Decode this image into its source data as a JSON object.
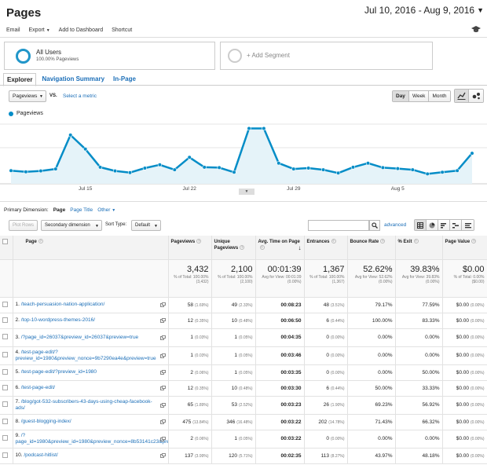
{
  "header": {
    "title": "Pages",
    "date_range": "Jul 10, 2016 - Aug 9, 2016",
    "actions": [
      "Email",
      "Export",
      "Add to Dashboard",
      "Shortcut"
    ]
  },
  "segments": {
    "active": {
      "name": "All Users",
      "sub": "100.00% Pageviews"
    },
    "add_label": "+ Add Segment"
  },
  "tabs": [
    "Explorer",
    "Navigation Summary",
    "In-Page"
  ],
  "metric": {
    "selected": "Pageviews",
    "vs": "VS.",
    "select_metric": "Select a metric"
  },
  "period_buttons": [
    "Day",
    "Week",
    "Month"
  ],
  "chart_data": {
    "type": "area",
    "series": [
      {
        "name": "Pageviews",
        "values": [
          80,
          72,
          78,
          90,
          295,
          210,
          100,
          78,
          68,
          95,
          115,
          85,
          160,
          100,
          98,
          70,
          335,
          335,
          125,
          90,
          95,
          85,
          65,
          100,
          125,
          98,
          92,
          85,
          60,
          70,
          80,
          185
        ]
      }
    ],
    "x_tick_labels": [
      "Jul 15",
      "Jul 22",
      "Jul 29",
      "Aug 5"
    ],
    "ylim": [
      0,
      380
    ],
    "grid": true,
    "color": "#058dc7"
  },
  "primary_dimension": {
    "label": "Primary Dimension:",
    "options": [
      "Page",
      "Page Title",
      "Other"
    ]
  },
  "toolbar": {
    "plot_rows": "Plot Rows",
    "secondary_dimension": "Secondary dimension",
    "sort_type_label": "Sort Type:",
    "sort_type": "Default",
    "advanced": "advanced"
  },
  "table": {
    "columns": [
      "Page",
      "Pageviews",
      "Unique Pageviews",
      "Avg. Time on Page",
      "Entrances",
      "Bounce Rate",
      "% Exit",
      "Page Value"
    ],
    "totals": [
      {
        "value": "3,432",
        "sub": "% of Total: 100.00% (3,432)"
      },
      {
        "value": "2,100",
        "sub": "% of Total: 100.00% (2,100)"
      },
      {
        "value": "00:01:39",
        "sub": "Avg for View: 00:01:39 (0.00%)"
      },
      {
        "value": "1,367",
        "sub": "% of Total: 100.00% (1,367)"
      },
      {
        "value": "52.62%",
        "sub": "Avg for View: 52.62% (0.00%)"
      },
      {
        "value": "39.83%",
        "sub": "Avg for View: 39.83% (0.00%)"
      },
      {
        "value": "$0.00",
        "sub": "% of Total: 0.00% ($0.00)"
      }
    ],
    "rows": [
      {
        "idx": "1.",
        "page": "/teach-persuasion-nation-application/",
        "pv": "58",
        "pv_pct": "(1.69%)",
        "upv": "49",
        "upv_pct": "(2.33%)",
        "time": "00:08:23",
        "ent": "48",
        "ent_pct": "(3.51%)",
        "bounce": "79.17%",
        "exit": "77.59%",
        "value": "$0.00",
        "value_pct": "(0.00%)"
      },
      {
        "idx": "2.",
        "page": "/top-10-wordpress-themes-2016/",
        "pv": "12",
        "pv_pct": "(0.35%)",
        "upv": "10",
        "upv_pct": "(0.48%)",
        "time": "00:06:50",
        "ent": "6",
        "ent_pct": "(0.44%)",
        "bounce": "100.00%",
        "exit": "83.33%",
        "value": "$0.00",
        "value_pct": "(0.00%)"
      },
      {
        "idx": "3.",
        "page": "/?page_id=26037&preview_id=26037&preview=true",
        "pv": "1",
        "pv_pct": "(0.03%)",
        "upv": "1",
        "upv_pct": "(0.05%)",
        "time": "00:04:35",
        "ent": "0",
        "ent_pct": "(0.00%)",
        "bounce": "0.00%",
        "exit": "0.00%",
        "value": "$0.00",
        "value_pct": "(0.00%)"
      },
      {
        "idx": "4.",
        "page": "/test-page-edit/?preview_id=1980&preview_nonce=9b7290ea4e&preview=true",
        "pv": "1",
        "pv_pct": "(0.03%)",
        "upv": "1",
        "upv_pct": "(0.05%)",
        "time": "00:03:46",
        "ent": "0",
        "ent_pct": "(0.00%)",
        "bounce": "0.00%",
        "exit": "0.00%",
        "value": "$0.00",
        "value_pct": "(0.00%)"
      },
      {
        "idx": "5.",
        "page": "/test-page-edit/?preview_id=1980",
        "pv": "2",
        "pv_pct": "(0.06%)",
        "upv": "1",
        "upv_pct": "(0.05%)",
        "time": "00:03:35",
        "ent": "0",
        "ent_pct": "(0.00%)",
        "bounce": "0.00%",
        "exit": "50.00%",
        "value": "$0.00",
        "value_pct": "(0.00%)"
      },
      {
        "idx": "6.",
        "page": "/test-page-edit/",
        "pv": "12",
        "pv_pct": "(0.35%)",
        "upv": "10",
        "upv_pct": "(0.48%)",
        "time": "00:03:30",
        "ent": "6",
        "ent_pct": "(0.44%)",
        "bounce": "50.00%",
        "exit": "33.33%",
        "value": "$0.00",
        "value_pct": "(0.00%)"
      },
      {
        "idx": "7.",
        "page": "/blog/got-532-subscribers-43-days-using-cheap-facebook-ads/",
        "pv": "65",
        "pv_pct": "(1.89%)",
        "upv": "53",
        "upv_pct": "(2.52%)",
        "time": "00:03:23",
        "ent": "26",
        "ent_pct": "(1.90%)",
        "bounce": "69.23%",
        "exit": "56.92%",
        "value": "$0.00",
        "value_pct": "(0.00%)"
      },
      {
        "idx": "8.",
        "page": "/guest-blogging-index/",
        "pv": "475",
        "pv_pct": "(13.84%)",
        "upv": "346",
        "upv_pct": "(16.48%)",
        "time": "00:03:22",
        "ent": "202",
        "ent_pct": "(14.78%)",
        "bounce": "71.43%",
        "exit": "66.32%",
        "value": "$0.00",
        "value_pct": "(0.00%)"
      },
      {
        "idx": "9.",
        "page": "/?page_id=1980&preview_id=1980&preview_nonce=8b53141c23&preview=true",
        "pv": "2",
        "pv_pct": "(0.06%)",
        "upv": "1",
        "upv_pct": "(0.05%)",
        "time": "00:03:22",
        "ent": "0",
        "ent_pct": "(0.00%)",
        "bounce": "0.00%",
        "exit": "0.00%",
        "value": "$0.00",
        "value_pct": "(0.00%)"
      },
      {
        "idx": "10.",
        "page": "/podcast-hitlist/",
        "pv": "137",
        "pv_pct": "(3.99%)",
        "upv": "120",
        "upv_pct": "(5.71%)",
        "time": "00:02:35",
        "ent": "113",
        "ent_pct": "(8.27%)",
        "bounce": "43.97%",
        "exit": "48.18%",
        "value": "$0.00",
        "value_pct": "(0.00%)"
      }
    ]
  }
}
